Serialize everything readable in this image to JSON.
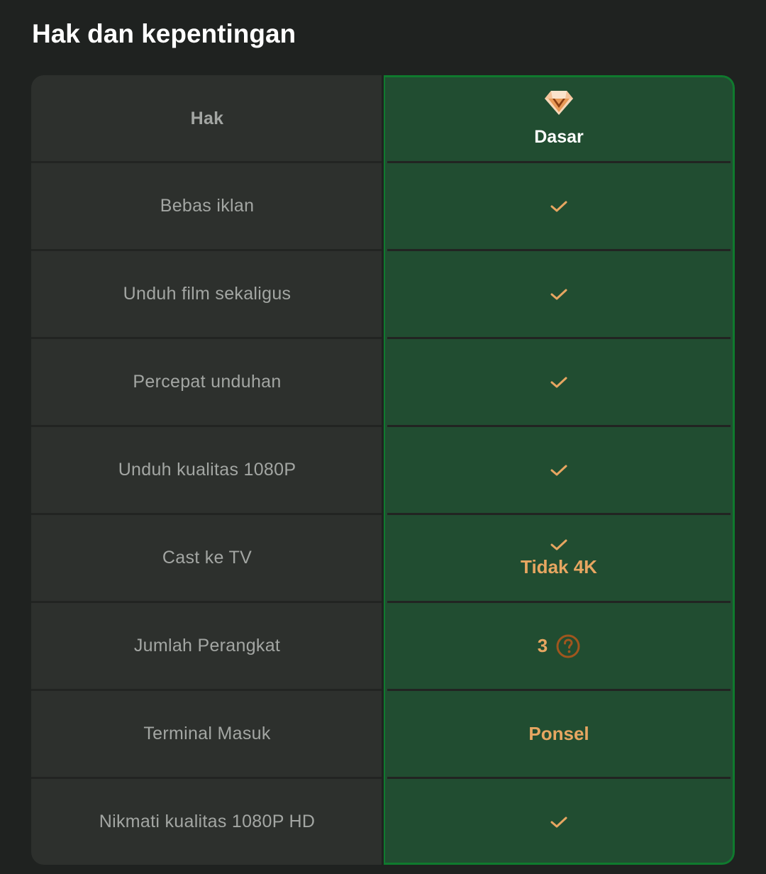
{
  "page": {
    "title": "Hak dan kepentingan"
  },
  "table": {
    "header": {
      "left_label": "Hak",
      "plan_label": "Dasar",
      "plan_icon": "diamond-icon"
    },
    "rows": [
      {
        "label": "Bebas iklan",
        "value_type": "check"
      },
      {
        "label": "Unduh film sekaligus",
        "value_type": "check"
      },
      {
        "label": "Percepat unduhan",
        "value_type": "check"
      },
      {
        "label": "Unduh kualitas 1080P",
        "value_type": "check"
      },
      {
        "label": "Cast ke TV",
        "value_type": "check",
        "note": "Tidak 4K"
      },
      {
        "label": "Jumlah Perangkat",
        "value": "3",
        "help_icon": "question-circle-icon"
      },
      {
        "label": "Terminal Masuk",
        "value": "Ponsel"
      },
      {
        "label": "Nikmati kualitas 1080P HD",
        "value_type": "check"
      }
    ]
  },
  "colors": {
    "background": "#1f2220",
    "cell": "#2d302d",
    "plan_column": "#214d31",
    "plan_border": "#0f7a2e",
    "accent": "#e7a661",
    "help_icon": "#a0561e",
    "label_text": "#a3a6a3"
  }
}
